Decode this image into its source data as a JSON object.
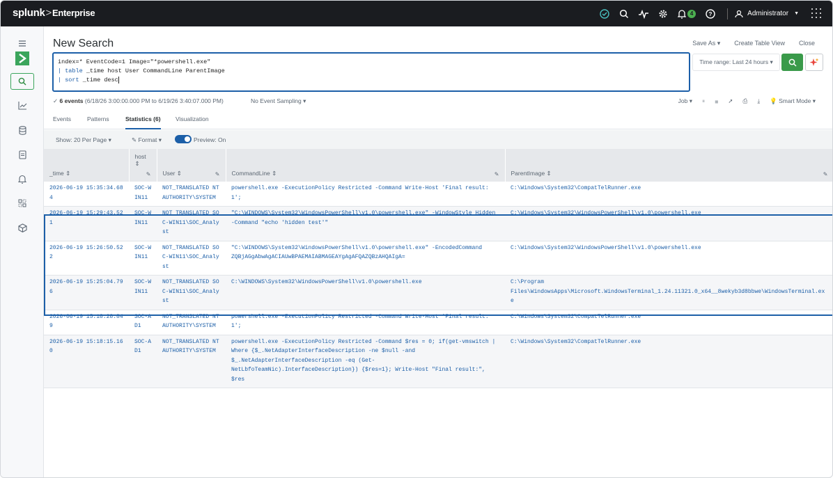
{
  "app": {
    "logo": "splunk",
    "logo_sep": ">",
    "product": "Enterprise",
    "notif_count": "4",
    "user": "Administrator"
  },
  "header": {
    "title": "New Search",
    "save_as": "Save As ▾",
    "create_table": "Create Table View",
    "close": "Close"
  },
  "search": {
    "line1": "index=* EventCode=1 Image=\"*powershell.exe\"",
    "line2_pipe": "| ",
    "line2_cmd": "table",
    "line2_rest": " _time host User CommandLine ParentImage",
    "line3_pipe": "| ",
    "line3_cmd": "sort",
    "line3_rest": " _time desc",
    "time_range": "Time range: Last 24 hours ▾"
  },
  "status": {
    "events": "6 events",
    "range": "(6/18/26 3:00:00.000 PM to 6/19/26 3:40:07.000 PM)",
    "sampling": "No Event Sampling ▾",
    "job": "Job ▾",
    "mode": "Smart Mode ▾"
  },
  "tabs": [
    "Events",
    "Patterns",
    "Statistics (6)",
    "Visualization"
  ],
  "toolbar": {
    "show": "Show: 20 Per Page ▾",
    "format": "Format ▾",
    "preview": "Preview: On"
  },
  "columns": [
    "_time ⇕",
    "host",
    "User ⇕",
    "CommandLine ⇕",
    "ParentImage ⇕"
  ],
  "host_sort": "⇕",
  "rows": [
    {
      "time": "2026-06-19 15:35:34.684",
      "host": "SOC-WIN11",
      "user": "NOT_TRANSLATED NT AUTHORITY\\SYSTEM",
      "cmd": "powershell.exe -ExecutionPolicy Restricted -Command Write-Host 'Final result: 1';",
      "parent": "C:\\Windows\\System32\\CompatTelRunner.exe"
    },
    {
      "time": "2026-06-19 15:29:43.521",
      "host": "SOC-WIN11",
      "user": "NOT_TRANSLATED SOC-WIN11\\SOC_Analyst",
      "cmd": "\"C:\\WINDOWS\\System32\\WindowsPowerShell\\v1.0\\powershell.exe\" -WindowStyle Hidden -Command \"echo 'hidden test'\"",
      "parent": "C:\\Windows\\System32\\WindowsPowerShell\\v1.0\\powershell.exe"
    },
    {
      "time": "2026-06-19 15:26:50.522",
      "host": "SOC-WIN11",
      "user": "NOT_TRANSLATED SOC-WIN11\\SOC_Analyst",
      "cmd": "\"C:\\WINDOWS\\System32\\WindowsPowerShell\\v1.0\\powershell.exe\" -EncodedCommand ZQBjAGgAbwAgACIAUwBPAEMAIABMAGEAYgAgAFQAZQBzAHQAIgA=",
      "parent": "C:\\Windows\\System32\\WindowsPowerShell\\v1.0\\powershell.exe"
    },
    {
      "time": "2026-06-19 15:25:04.796",
      "host": "SOC-WIN11",
      "user": "NOT_TRANSLATED SOC-WIN11\\SOC_Analyst",
      "cmd": "C:\\WINDOWS\\System32\\WindowsPowerShell\\v1.0\\powershell.exe",
      "parent": "C:\\Program Files\\WindowsApps\\Microsoft.WindowsTerminal_1.24.11321.0_x64__8wekyb3d8bbwe\\WindowsTerminal.exe"
    },
    {
      "time": "2026-06-19 15:18:28.849",
      "host": "SOC-AD1",
      "user": "NOT_TRANSLATED NT AUTHORITY\\SYSTEM",
      "cmd": "powershell.exe -ExecutionPolicy Restricted -Command Write-Host 'Final result: 1';",
      "parent": "C:\\Windows\\System32\\CompatTelRunner.exe"
    },
    {
      "time": "2026-06-19 15:18:15.160",
      "host": "SOC-AD1",
      "user": "NOT_TRANSLATED NT AUTHORITY\\SYSTEM",
      "cmd": "powershell.exe -ExecutionPolicy Restricted -Command $res = 0; if(get-vmswitch | Where {$_.NetAdapterInterfaceDescription -ne $null -and $_.NetAdapterInterfaceDescription -eq (Get-NetLbfoTeamNic).InterfaceDescription}) {$res=1}; Write-Host \"Final result:\", $res",
      "parent": "C:\\Windows\\System32\\CompatTelRunner.exe"
    }
  ],
  "colors": {
    "accent": "#1c5fa8",
    "brand_green": "#3a9a4a",
    "topbar": "#1a1c20"
  }
}
